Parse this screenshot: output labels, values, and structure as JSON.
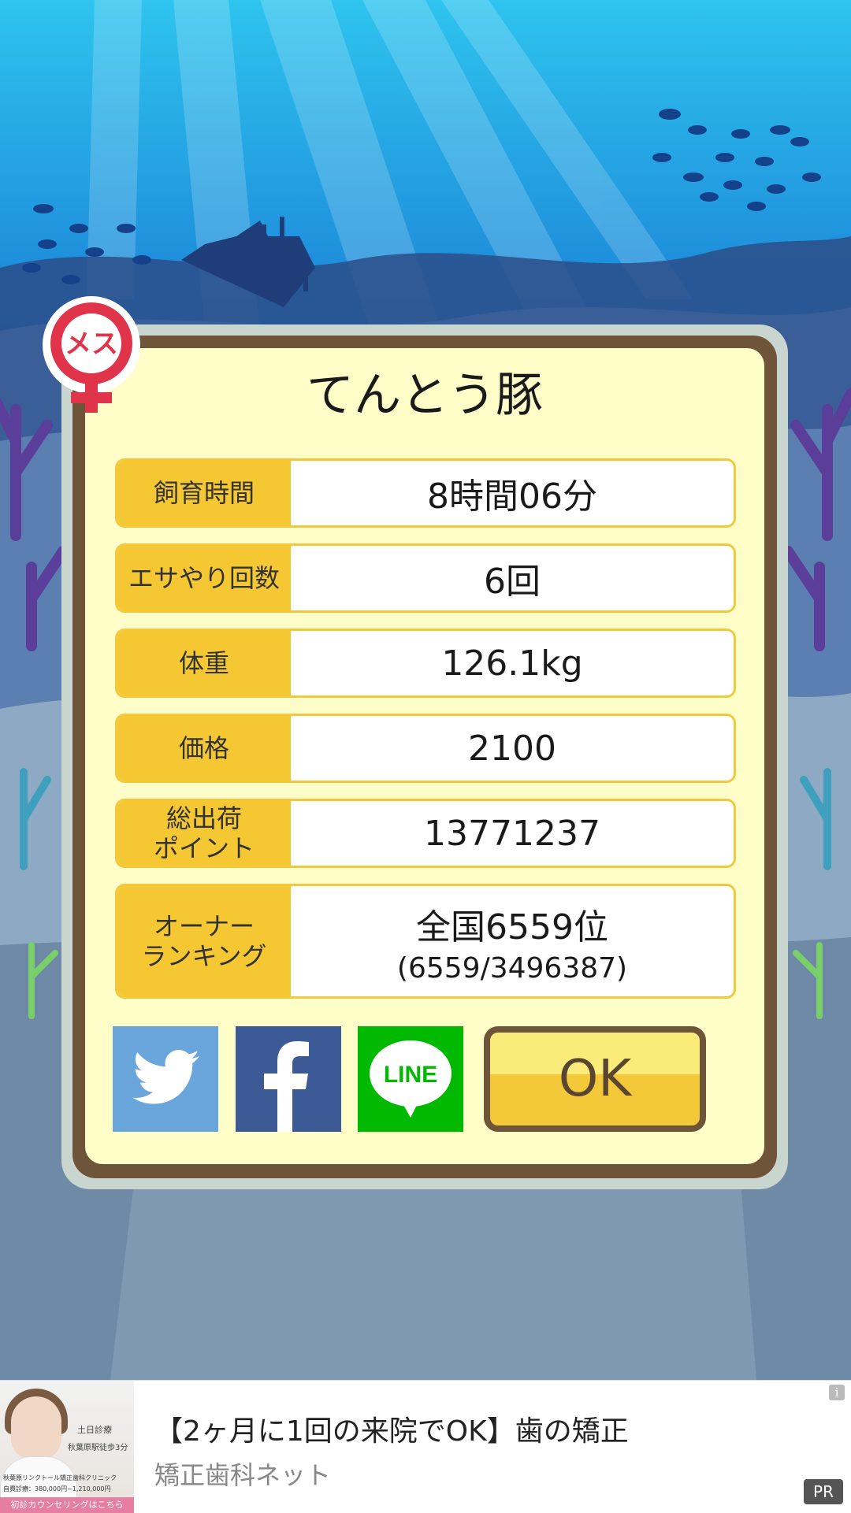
{
  "pig": {
    "name": "てんとう豚",
    "gender_badge": "メス"
  },
  "stats": [
    {
      "label": "飼育時間",
      "value": "8時間06分"
    },
    {
      "label": "エサやり回数",
      "value": "6回"
    },
    {
      "label": "体重",
      "value": "126.1kg"
    },
    {
      "label": "価格",
      "value": "2100"
    },
    {
      "label": "総出荷\nポイント",
      "value": "13771237"
    },
    {
      "label": "オーナー\nランキング",
      "value": "全国6559位",
      "sub": "(6559/3496387)"
    }
  ],
  "share": [
    {
      "service": "Twitter",
      "icon": "twitter-icon",
      "color": "#6aa6dc"
    },
    {
      "service": "Facebook",
      "icon": "facebook-icon",
      "color": "#3b5a96"
    },
    {
      "service": "LINE",
      "icon": "line-icon",
      "label": "LINE",
      "color": "#00b900"
    }
  ],
  "ok_label": "OK",
  "ad": {
    "title": "【2ヶ月に1回の来院でOK】歯の矯正",
    "advertiser": "矯正歯科ネット",
    "pr_label": "PR",
    "info_label": "i",
    "image_text": {
      "line1": "土日診療",
      "line2": "秋葉原駅徒歩3分",
      "line3": "秋葉原リンクトール矯正歯科クリニック",
      "line4": "自費診療：380,000円~1,210,000円",
      "cta": "初診カウンセリングはこちら"
    }
  },
  "colors": {
    "panel_face": "#fffdc8",
    "label_bg": "#f5c833",
    "frame": "#6e5438",
    "badge": "#e0344a"
  }
}
